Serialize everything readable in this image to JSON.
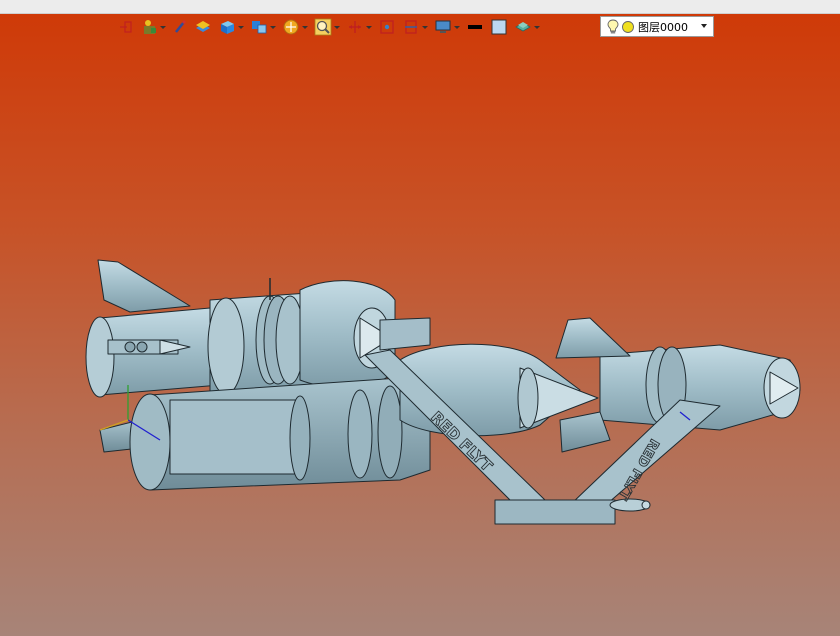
{
  "colors": {
    "viewport_top": "#cf3a08",
    "viewport_bottom": "#a78478",
    "model_fill": "#9fbcc7",
    "model_edge": "#1e2a30",
    "decal": "#2a3236"
  },
  "toolbar": {
    "buttons": [
      {
        "name": "snap-point-icon",
        "has_menu": false
      },
      {
        "name": "coordinate-system-icon",
        "has_menu": true
      },
      {
        "name": "pen-icon",
        "has_menu": false
      },
      {
        "name": "layer-stack-icon",
        "has_menu": false
      },
      {
        "name": "solid-cube-icon",
        "has_menu": true
      },
      {
        "name": "view-orientation-icon",
        "has_menu": true
      },
      {
        "name": "display-style-icon",
        "has_menu": true
      },
      {
        "name": "zoom-icon",
        "has_menu": true
      },
      {
        "name": "dimension-icon",
        "has_menu": true
      },
      {
        "name": "section-view-icon",
        "has_menu": false
      },
      {
        "name": "clip-plane-icon",
        "has_menu": true
      },
      {
        "name": "monitor-icon",
        "has_menu": true
      },
      {
        "name": "line-color-icon",
        "has_menu": false
      },
      {
        "name": "fill-color-icon",
        "has_menu": false
      },
      {
        "name": "layer-visibility-icon",
        "has_menu": true
      }
    ]
  },
  "layer": {
    "current": "图层0000"
  },
  "model": {
    "decal_text": "RED FLYT"
  }
}
